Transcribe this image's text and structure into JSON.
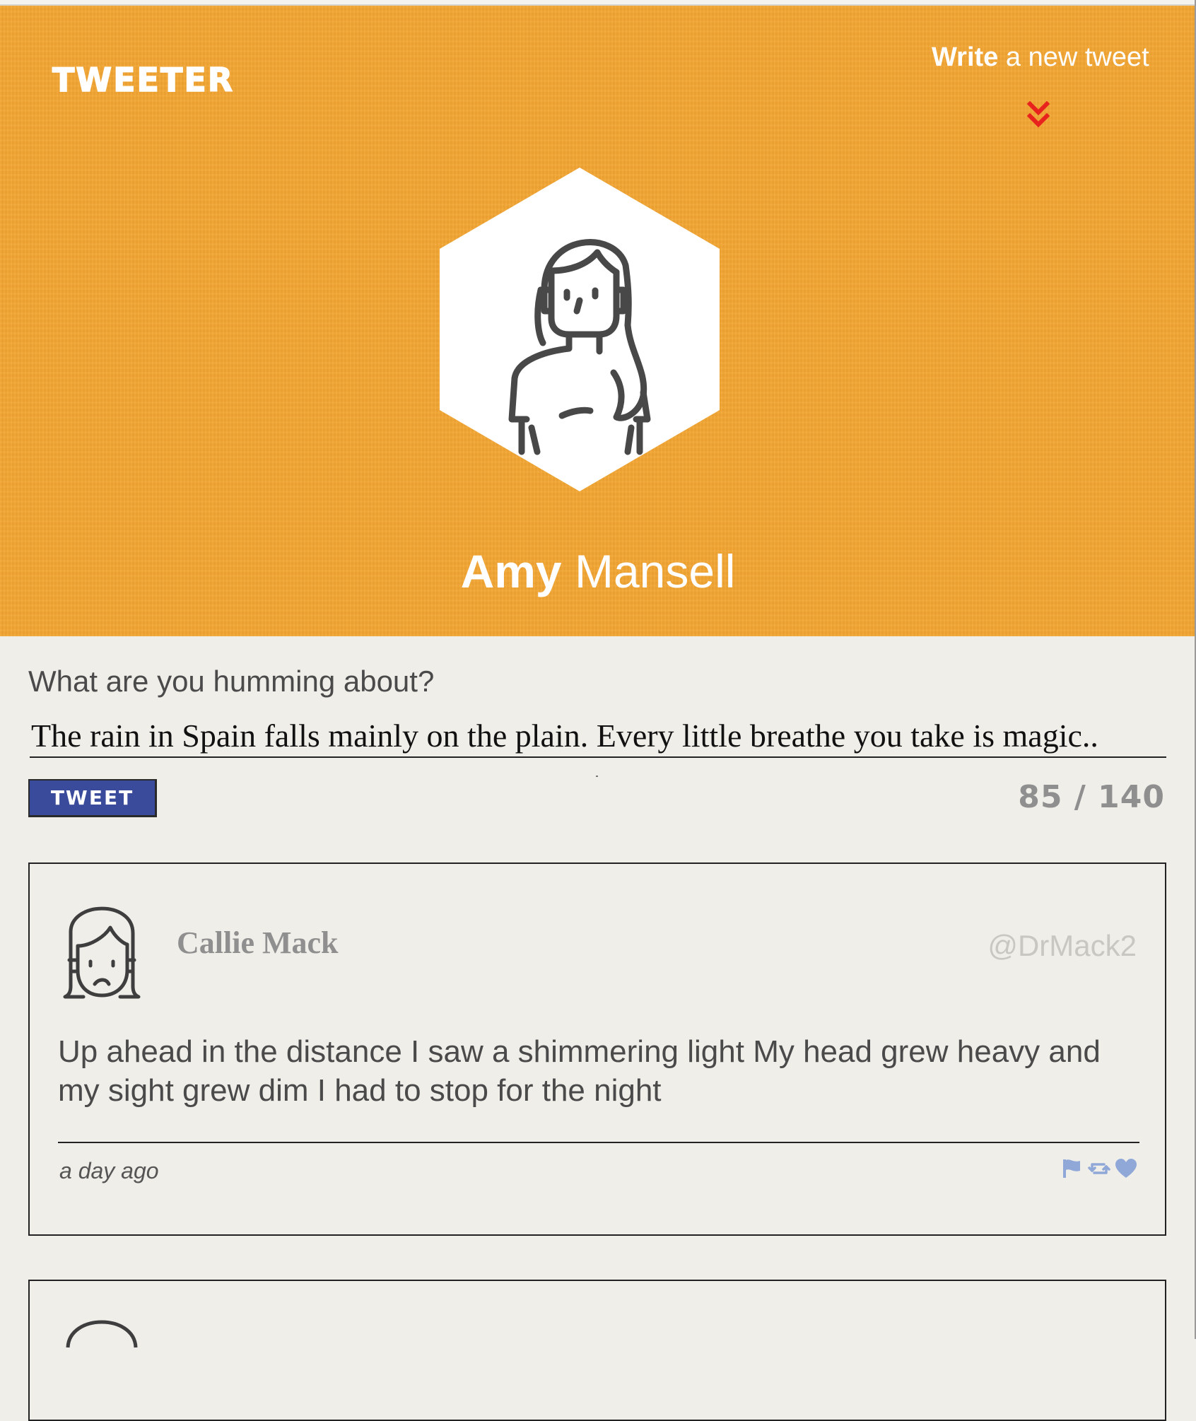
{
  "nav": {
    "brand": "TWEETER",
    "write_strong": "Write",
    "write_rest": " a new tweet",
    "chevron_color": "#e8231d"
  },
  "profile": {
    "first_name": "Amy",
    "last_name": " Mansell",
    "avatar_icon": "woman-avatar-icon",
    "header_color": "#f3a533"
  },
  "compose": {
    "label": "What are you humming about?",
    "text": "The rain in Spain falls mainly on the plain. Every little breathe you take is magic..",
    "button_label": "TWEET",
    "button_color": "#3b4b9c",
    "counter": "85 / 140"
  },
  "tweets": [
    {
      "author": "Callie Mack",
      "handle": "@DrMack2",
      "text": "Up ahead in the distance I saw a shimmering light My head grew heavy and my sight grew dim I had to stop for the night",
      "time": "a day ago",
      "avatar_icon": "sad-woman-avatar-icon",
      "actions": [
        "flag-icon",
        "retweet-icon",
        "heart-icon"
      ],
      "action_color": "#8fa8d8"
    }
  ]
}
